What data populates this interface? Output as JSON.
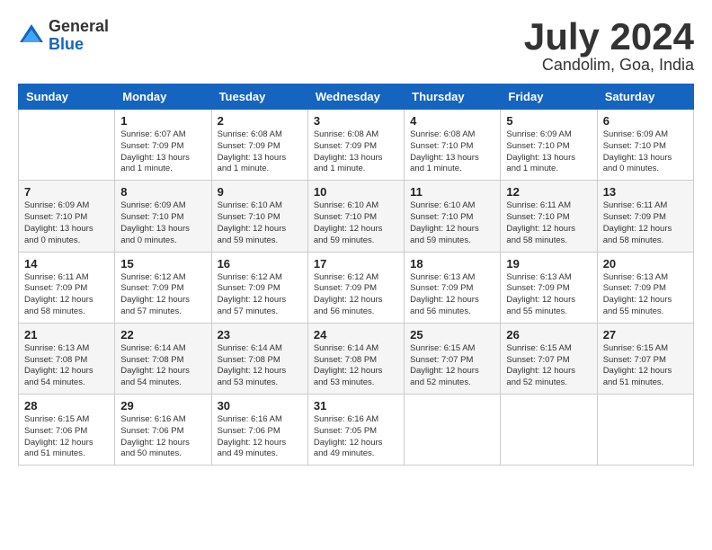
{
  "logo": {
    "general": "General",
    "blue": "Blue"
  },
  "title": {
    "month": "July 2024",
    "location": "Candolim, Goa, India"
  },
  "weekdays": [
    "Sunday",
    "Monday",
    "Tuesday",
    "Wednesday",
    "Thursday",
    "Friday",
    "Saturday"
  ],
  "weeks": [
    [
      {
        "day": "",
        "info": ""
      },
      {
        "day": "1",
        "info": "Sunrise: 6:07 AM\nSunset: 7:09 PM\nDaylight: 13 hours\nand 1 minute."
      },
      {
        "day": "2",
        "info": "Sunrise: 6:08 AM\nSunset: 7:09 PM\nDaylight: 13 hours\nand 1 minute."
      },
      {
        "day": "3",
        "info": "Sunrise: 6:08 AM\nSunset: 7:09 PM\nDaylight: 13 hours\nand 1 minute."
      },
      {
        "day": "4",
        "info": "Sunrise: 6:08 AM\nSunset: 7:10 PM\nDaylight: 13 hours\nand 1 minute."
      },
      {
        "day": "5",
        "info": "Sunrise: 6:09 AM\nSunset: 7:10 PM\nDaylight: 13 hours\nand 1 minute."
      },
      {
        "day": "6",
        "info": "Sunrise: 6:09 AM\nSunset: 7:10 PM\nDaylight: 13 hours\nand 0 minutes."
      }
    ],
    [
      {
        "day": "7",
        "info": "Sunrise: 6:09 AM\nSunset: 7:10 PM\nDaylight: 13 hours\nand 0 minutes."
      },
      {
        "day": "8",
        "info": "Sunrise: 6:09 AM\nSunset: 7:10 PM\nDaylight: 13 hours\nand 0 minutes."
      },
      {
        "day": "9",
        "info": "Sunrise: 6:10 AM\nSunset: 7:10 PM\nDaylight: 12 hours\nand 59 minutes."
      },
      {
        "day": "10",
        "info": "Sunrise: 6:10 AM\nSunset: 7:10 PM\nDaylight: 12 hours\nand 59 minutes."
      },
      {
        "day": "11",
        "info": "Sunrise: 6:10 AM\nSunset: 7:10 PM\nDaylight: 12 hours\nand 59 minutes."
      },
      {
        "day": "12",
        "info": "Sunrise: 6:11 AM\nSunset: 7:10 PM\nDaylight: 12 hours\nand 58 minutes."
      },
      {
        "day": "13",
        "info": "Sunrise: 6:11 AM\nSunset: 7:09 PM\nDaylight: 12 hours\nand 58 minutes."
      }
    ],
    [
      {
        "day": "14",
        "info": "Sunrise: 6:11 AM\nSunset: 7:09 PM\nDaylight: 12 hours\nand 58 minutes."
      },
      {
        "day": "15",
        "info": "Sunrise: 6:12 AM\nSunset: 7:09 PM\nDaylight: 12 hours\nand 57 minutes."
      },
      {
        "day": "16",
        "info": "Sunrise: 6:12 AM\nSunset: 7:09 PM\nDaylight: 12 hours\nand 57 minutes."
      },
      {
        "day": "17",
        "info": "Sunrise: 6:12 AM\nSunset: 7:09 PM\nDaylight: 12 hours\nand 56 minutes."
      },
      {
        "day": "18",
        "info": "Sunrise: 6:13 AM\nSunset: 7:09 PM\nDaylight: 12 hours\nand 56 minutes."
      },
      {
        "day": "19",
        "info": "Sunrise: 6:13 AM\nSunset: 7:09 PM\nDaylight: 12 hours\nand 55 minutes."
      },
      {
        "day": "20",
        "info": "Sunrise: 6:13 AM\nSunset: 7:09 PM\nDaylight: 12 hours\nand 55 minutes."
      }
    ],
    [
      {
        "day": "21",
        "info": "Sunrise: 6:13 AM\nSunset: 7:08 PM\nDaylight: 12 hours\nand 54 minutes."
      },
      {
        "day": "22",
        "info": "Sunrise: 6:14 AM\nSunset: 7:08 PM\nDaylight: 12 hours\nand 54 minutes."
      },
      {
        "day": "23",
        "info": "Sunrise: 6:14 AM\nSunset: 7:08 PM\nDaylight: 12 hours\nand 53 minutes."
      },
      {
        "day": "24",
        "info": "Sunrise: 6:14 AM\nSunset: 7:08 PM\nDaylight: 12 hours\nand 53 minutes."
      },
      {
        "day": "25",
        "info": "Sunrise: 6:15 AM\nSunset: 7:07 PM\nDaylight: 12 hours\nand 52 minutes."
      },
      {
        "day": "26",
        "info": "Sunrise: 6:15 AM\nSunset: 7:07 PM\nDaylight: 12 hours\nand 52 minutes."
      },
      {
        "day": "27",
        "info": "Sunrise: 6:15 AM\nSunset: 7:07 PM\nDaylight: 12 hours\nand 51 minutes."
      }
    ],
    [
      {
        "day": "28",
        "info": "Sunrise: 6:15 AM\nSunset: 7:06 PM\nDaylight: 12 hours\nand 51 minutes."
      },
      {
        "day": "29",
        "info": "Sunrise: 6:16 AM\nSunset: 7:06 PM\nDaylight: 12 hours\nand 50 minutes."
      },
      {
        "day": "30",
        "info": "Sunrise: 6:16 AM\nSunset: 7:06 PM\nDaylight: 12 hours\nand 49 minutes."
      },
      {
        "day": "31",
        "info": "Sunrise: 6:16 AM\nSunset: 7:05 PM\nDaylight: 12 hours\nand 49 minutes."
      },
      {
        "day": "",
        "info": ""
      },
      {
        "day": "",
        "info": ""
      },
      {
        "day": "",
        "info": ""
      }
    ]
  ]
}
